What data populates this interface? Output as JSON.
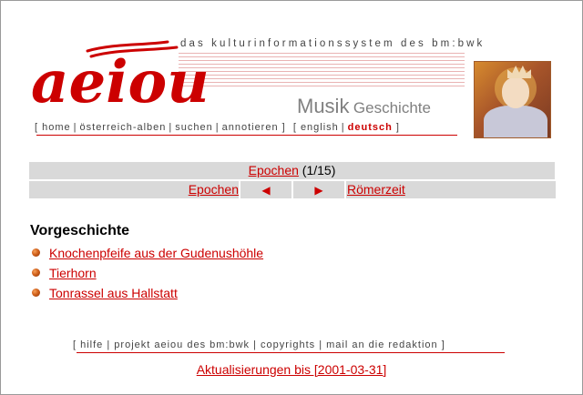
{
  "header": {
    "tagline": "das kulturinformationssystem des bm:bwk",
    "logo_text": "aeiou",
    "subtitle_main": "Musik",
    "subtitle_sub": "Geschichte"
  },
  "topnav": {
    "items": [
      "home",
      "österreich-alben",
      "suchen",
      "annotieren"
    ],
    "lang_english": "english",
    "lang_deutsch": "deutsch"
  },
  "epochen": {
    "label": "Epochen",
    "position": "(1/15)",
    "prev_label": "Epochen",
    "next_label": "Römerzeit"
  },
  "section": {
    "title": "Vorgeschichte",
    "items": [
      {
        "label": "Knochenpfeife aus der Gudenushöhle"
      },
      {
        "label": "Tierhorn"
      },
      {
        "label": "Tonrassel aus Hallstatt"
      }
    ]
  },
  "footer": {
    "links": [
      "hilfe",
      "projekt aeiou des bm:bwk",
      "copyrights",
      "mail an die redaktion"
    ],
    "update_text": "Aktualisierungen bis [2001-03-31]"
  },
  "colors": {
    "accent": "#cc0000",
    "bar": "#d9d9d9"
  }
}
